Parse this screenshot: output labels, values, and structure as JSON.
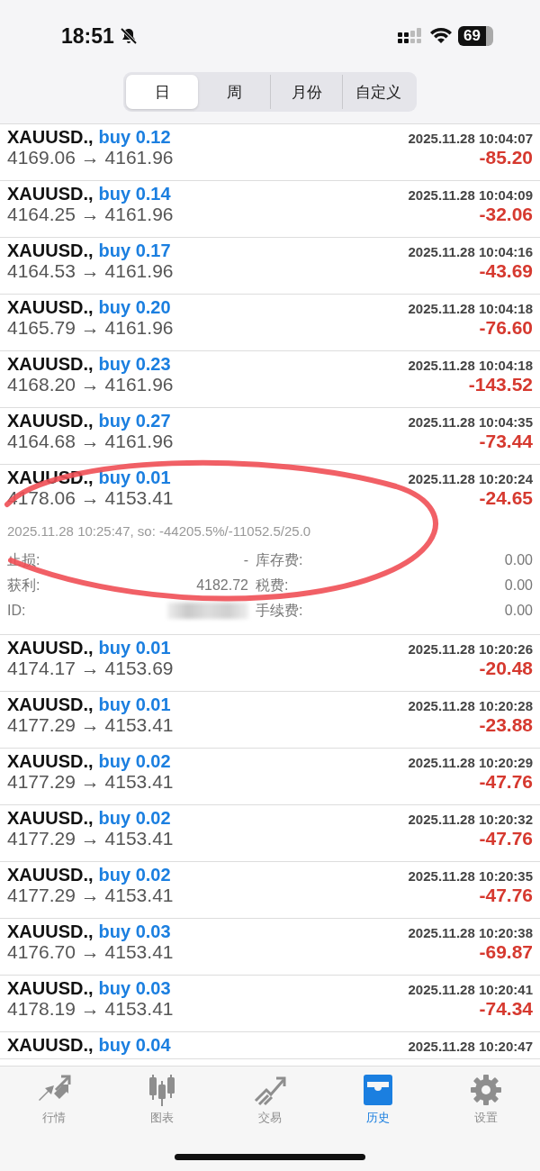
{
  "status_bar": {
    "time": "18:51",
    "battery": "69"
  },
  "segments": [
    {
      "label": "日",
      "selected": true
    },
    {
      "label": "周",
      "selected": false
    },
    {
      "label": "月份",
      "selected": false
    },
    {
      "label": "自定义",
      "selected": false
    }
  ],
  "trades": [
    {
      "symbol": "XAUUSD.,",
      "side": "buy 0.12",
      "time": "2025.11.28 10:04:07",
      "prices": "4169.06 → 4161.96",
      "profit": "-85.20"
    },
    {
      "symbol": "XAUUSD.,",
      "side": "buy 0.14",
      "time": "2025.11.28 10:04:09",
      "prices": "4164.25 → 4161.96",
      "profit": "-32.06"
    },
    {
      "symbol": "XAUUSD.,",
      "side": "buy 0.17",
      "time": "2025.11.28 10:04:16",
      "prices": "4164.53 → 4161.96",
      "profit": "-43.69"
    },
    {
      "symbol": "XAUUSD.,",
      "side": "buy 0.20",
      "time": "2025.11.28 10:04:18",
      "prices": "4165.79 → 4161.96",
      "profit": "-76.60"
    },
    {
      "symbol": "XAUUSD.,",
      "side": "buy 0.23",
      "time": "2025.11.28 10:04:18",
      "prices": "4168.20 → 4161.96",
      "profit": "-143.52"
    },
    {
      "symbol": "XAUUSD.,",
      "side": "buy 0.27",
      "time": "2025.11.28 10:04:35",
      "prices": "4164.68 → 4161.96",
      "profit": "-73.44"
    },
    {
      "symbol": "XAUUSD.,",
      "side": "buy 0.01",
      "time": "2025.11.28 10:20:24",
      "prices": "4178.06 → 4153.41",
      "profit": "-24.65",
      "details": {
        "comment": "2025.11.28 10:25:47, so: -44205.5%/-11052.5/25.0",
        "rows": [
          {
            "left_label": "止损:",
            "left_value": "-",
            "right_label": "库存费:",
            "right_value": "0.00"
          },
          {
            "left_label": "获利:",
            "left_value": "4182.72",
            "right_label": "税费:",
            "right_value": "0.00"
          },
          {
            "left_label": "ID:",
            "right_label": "手续费:",
            "right_value": "0.00"
          }
        ]
      }
    },
    {
      "symbol": "XAUUSD.,",
      "side": "buy 0.01",
      "time": "2025.11.28 10:20:26",
      "prices": "4174.17 → 4153.69",
      "profit": "-20.48"
    },
    {
      "symbol": "XAUUSD.,",
      "side": "buy 0.01",
      "time": "2025.11.28 10:20:28",
      "prices": "4177.29 → 4153.41",
      "profit": "-23.88"
    },
    {
      "symbol": "XAUUSD.,",
      "side": "buy 0.02",
      "time": "2025.11.28 10:20:29",
      "prices": "4177.29 → 4153.41",
      "profit": "-47.76"
    },
    {
      "symbol": "XAUUSD.,",
      "side": "buy 0.02",
      "time": "2025.11.28 10:20:32",
      "prices": "4177.29 → 4153.41",
      "profit": "-47.76"
    },
    {
      "symbol": "XAUUSD.,",
      "side": "buy 0.02",
      "time": "2025.11.28 10:20:35",
      "prices": "4177.29 → 4153.41",
      "profit": "-47.76"
    },
    {
      "symbol": "XAUUSD.,",
      "side": "buy 0.03",
      "time": "2025.11.28 10:20:38",
      "prices": "4176.70 → 4153.41",
      "profit": "-69.87"
    },
    {
      "symbol": "XAUUSD.,",
      "side": "buy 0.03",
      "time": "2025.11.28 10:20:41",
      "prices": "4178.19 → 4153.41",
      "profit": "-74.34"
    },
    {
      "symbol": "XAUUSD.,",
      "side": "buy 0.04",
      "time": "2025.11.28 10:20:47"
    }
  ],
  "tab_bar": [
    {
      "label": "行情",
      "selected": false
    },
    {
      "label": "图表",
      "selected": false
    },
    {
      "label": "交易",
      "selected": false
    },
    {
      "label": "历史",
      "selected": true
    },
    {
      "label": "设置",
      "selected": false
    }
  ]
}
